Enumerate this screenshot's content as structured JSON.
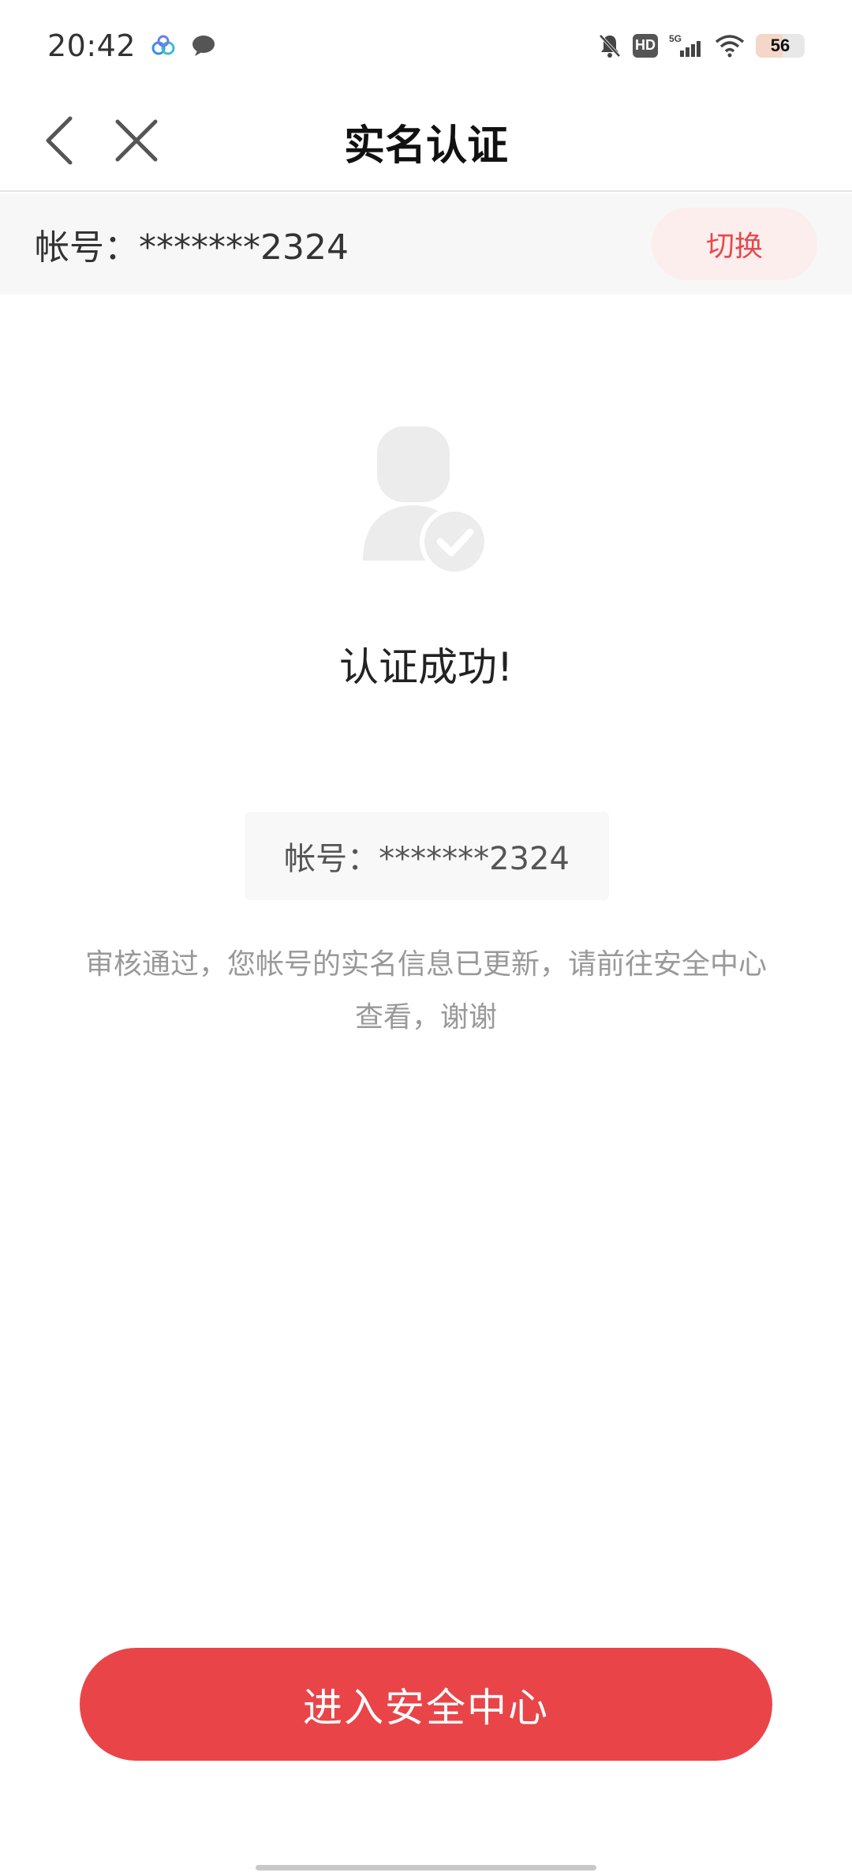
{
  "status_bar": {
    "time": "20:42",
    "network": "5G",
    "battery": "56",
    "icons": [
      "cloud-app-icon",
      "chat-bubble-icon",
      "bell-off-icon",
      "hd-icon",
      "signal-icon",
      "wifi-icon",
      "battery-icon"
    ]
  },
  "nav": {
    "title": "实名认证"
  },
  "account_strip": {
    "text": "帐号：*******2324",
    "switch_label": "切换"
  },
  "result": {
    "title": "认证成功!",
    "account_text": "帐号：*******2324",
    "description": "审核通过，您帐号的实名信息已更新，请前往安全中心查看，谢谢"
  },
  "cta": {
    "label": "进入安全中心"
  },
  "colors": {
    "accent": "#e94549",
    "switch_bg": "#fdeeee",
    "strip_bg": "#f7f7f7",
    "muted_text": "#999999"
  }
}
